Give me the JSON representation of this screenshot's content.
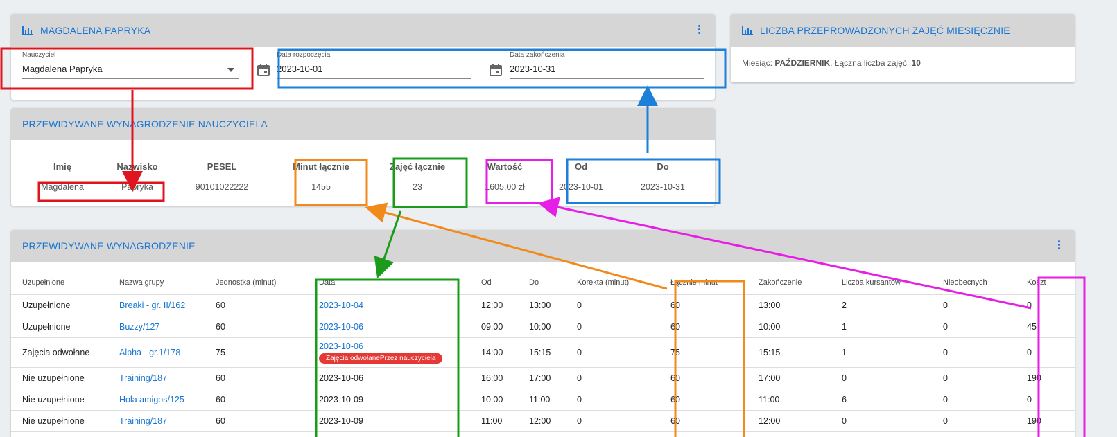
{
  "filter_card": {
    "title": "MAGDALENA PAPRYKA",
    "teacher_label": "Nauczyciel",
    "teacher_value": "Magdalena Papryka",
    "start_label": "Data rozpoczęcia",
    "start_value": "2023-10-01",
    "end_label": "Data zakończenia",
    "end_value": "2023-10-31"
  },
  "monthly_card": {
    "title": "LICZBA PRZEPROWADZONYCH ZAJĘĆ MIESIĘCZNIE",
    "month_prefix": "Miesiąc: ",
    "month_value": "PAŹDZIERNIK",
    "total_prefix": ", Łączna liczba zajęć: ",
    "total_value": "10"
  },
  "salary_card": {
    "title": "PRZEWIDYWANE WYNAGRODZENIE NAUCZYCIELA",
    "headers": {
      "first_name": "Imię",
      "last_name": "Nazwisko",
      "pesel": "PESEL",
      "minutes": "Minut łącznie",
      "lessons": "Zajęć łącznie",
      "value": "Wartość",
      "from": "Od",
      "to": "Do"
    },
    "values": {
      "first_name": "Magdalena",
      "last_name": "Papryka",
      "pesel": "90101022222",
      "minutes": "1455",
      "lessons": "23",
      "value": "1605.00 zł",
      "from": "2023-10-01",
      "to": "2023-10-31"
    }
  },
  "table_card": {
    "title": "PRZEWIDYWANE WYNAGRODZENIE",
    "columns": [
      "Uzupełnione",
      "Nazwa grupy",
      "Jednostka (minut)",
      "Data",
      "Od",
      "Do",
      "Korekta (minut)",
      "Łącznie minut",
      "Zakończenie",
      "Liczba kursantów",
      "Nieobecnych",
      "Koszt"
    ],
    "rows": [
      {
        "status": "Uzupełnione",
        "group": "Breaki - gr. II/162",
        "unit": "60",
        "date": "2023-10-04",
        "date_link": true,
        "badge": "",
        "from": "12:00",
        "to": "13:00",
        "corr": "0",
        "total": "60",
        "end": "13:00",
        "students": "2",
        "absent": "0",
        "cost": "0"
      },
      {
        "status": "Uzupełnione",
        "group": "Buzzy/127",
        "unit": "60",
        "date": "2023-10-06",
        "date_link": true,
        "badge": "",
        "from": "09:00",
        "to": "10:00",
        "corr": "0",
        "total": "60",
        "end": "10:00",
        "students": "1",
        "absent": "0",
        "cost": "45"
      },
      {
        "status": "Zajęcia odwołane",
        "group": "Alpha - gr.1/178",
        "unit": "75",
        "date": "2023-10-06",
        "date_link": true,
        "badge": "Zajęcia odwołanePrzez nauczyciela",
        "from": "14:00",
        "to": "15:15",
        "corr": "0",
        "total": "75",
        "end": "15:15",
        "students": "1",
        "absent": "0",
        "cost": "0"
      },
      {
        "status": "Nie uzupełnione",
        "group": "Training/187",
        "unit": "60",
        "date": "2023-10-06",
        "date_link": false,
        "badge": "",
        "from": "16:00",
        "to": "17:00",
        "corr": "0",
        "total": "60",
        "end": "17:00",
        "students": "0",
        "absent": "0",
        "cost": "190"
      },
      {
        "status": "Nie uzupełnione",
        "group": "Hola amigos/125",
        "unit": "60",
        "date": "2023-10-09",
        "date_link": false,
        "badge": "",
        "from": "10:00",
        "to": "11:00",
        "corr": "0",
        "total": "60",
        "end": "11:00",
        "students": "6",
        "absent": "0",
        "cost": "0"
      },
      {
        "status": "Nie uzupełnione",
        "group": "Training/187",
        "unit": "60",
        "date": "2023-10-09",
        "date_link": false,
        "badge": "",
        "from": "11:00",
        "to": "12:00",
        "corr": "0",
        "total": "60",
        "end": "12:00",
        "students": "0",
        "absent": "0",
        "cost": "190"
      }
    ]
  },
  "colors": {
    "accent": "#1976d2",
    "red": "#e0141e",
    "blue": "#1e7fd8",
    "orange": "#f28a1b",
    "green": "#1a9c1a",
    "magenta": "#e61ee6"
  }
}
